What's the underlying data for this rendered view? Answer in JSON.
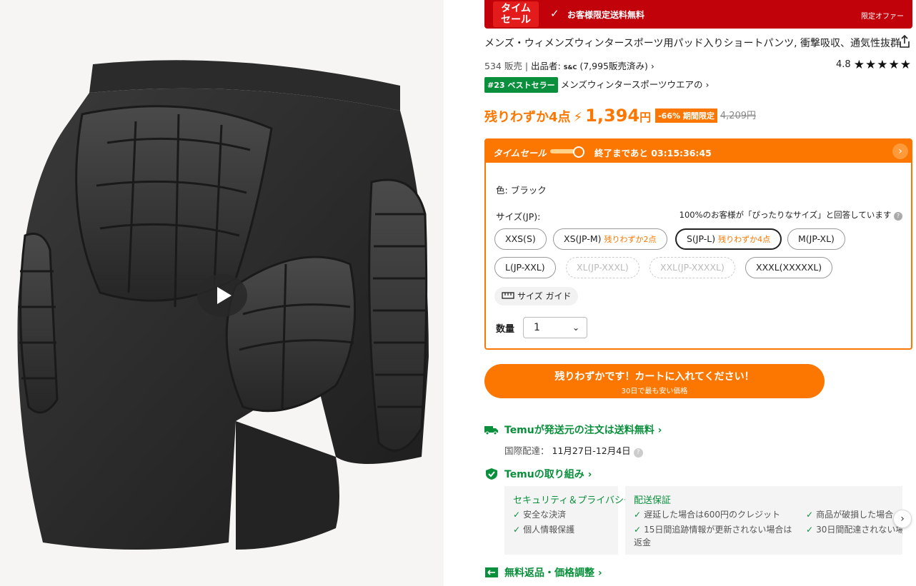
{
  "banner": {
    "time_sale": "タイム\nセール",
    "time_sale_l1": "タイム",
    "time_sale_l2": "セール",
    "check": "✓",
    "shipping": "お客様限定送料無料",
    "offer": "限定オファー"
  },
  "product": {
    "title": "メンズ・ウィメンズウィンタースポーツ用パッド入りショートパンツ, 衝撃吸収、通気性抜群",
    "sold": "534 販売",
    "seller_label": "出品者:",
    "seller_logo": "S&C",
    "seller_sales": "(7,995販売済み)",
    "rating": "4.8",
    "stars": "★★★★★",
    "best_badge": "#23 ベストセラー",
    "best_text": "メンズウィンタースポーツウエアの"
  },
  "price": {
    "few_left": "残りわずか4点",
    "bolt": "⚡",
    "amount": "1,394",
    "yen": "円",
    "discount": "-66% 期間限定",
    "original": "4,209円"
  },
  "timesale": {
    "label": "タイムセール",
    "countdown_label": "終了まであと",
    "countdown": "03:15:36:45",
    "arrow": "›"
  },
  "options": {
    "color_label": "色:",
    "color_value": "ブラック",
    "size_label": "サイズ(JP):",
    "fit_note": "100%のお客様が「ぴったりなサイズ」と回答しています",
    "sizes": [
      {
        "label": "XXS(S)",
        "note": ""
      },
      {
        "label": "XS(JP-M)",
        "note": "残りわずか2点"
      },
      {
        "label": "S(JP-L)",
        "note": "残りわずか4点"
      },
      {
        "label": "M(JP-XL)",
        "note": ""
      },
      {
        "label": "L(JP-XXL)",
        "note": ""
      },
      {
        "label": "XL(JP-XXXL)",
        "note": ""
      },
      {
        "label": "XXL(JP-XXXXL)",
        "note": ""
      },
      {
        "label": "XXXL(XXXXXL)",
        "note": ""
      }
    ],
    "selected_size": "S(JP-L)",
    "size_guide": "サイズ ガイド",
    "qty_label": "数量",
    "qty_value": "1"
  },
  "cta": {
    "line1": "残りわずかです！カートに入れてください！",
    "line2": "30日で最も安い価格"
  },
  "shipping": {
    "free_text": "Temuが発送元の注文は送料無料",
    "intl_label": "国際配達：",
    "intl_dates": "11月27日-12月4日"
  },
  "commitment": {
    "title": "Temuの取り組み",
    "security_title": "セキュリティ＆プライバシー",
    "security_items": [
      "安全な決済",
      "個人情報保護"
    ],
    "delivery_title": "配送保証",
    "delivery_items": [
      "遅延した場合は600円のクレジット",
      "15日間追跡情報が更新されない場合は",
      "返金"
    ],
    "delivery_items_b": [
      "商品が破損した場合",
      "30日間配達されない場"
    ]
  },
  "returns": {
    "title": "無料返品・価格調整"
  },
  "colors": {
    "accent": "#fb7701",
    "banner_red": "#c2020a",
    "green": "#0a8f3c"
  }
}
